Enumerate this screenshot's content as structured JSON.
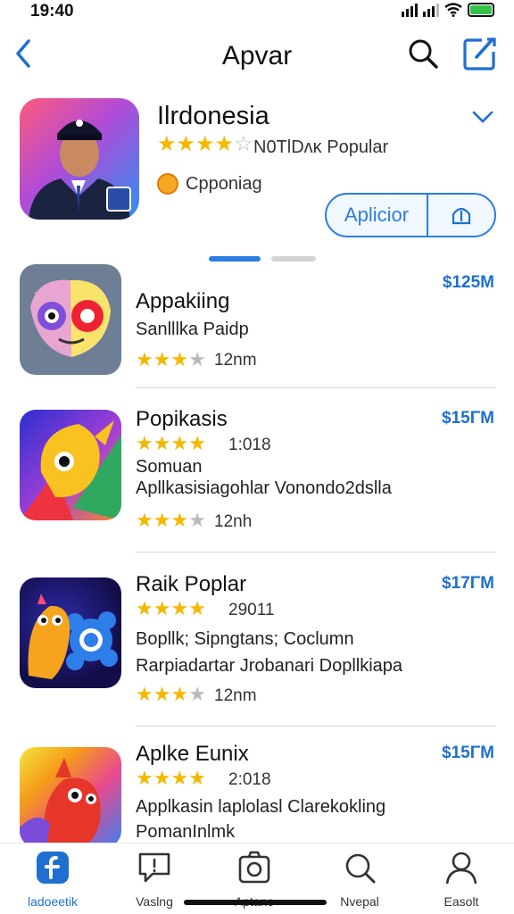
{
  "status": {
    "time": "19:40"
  },
  "nav": {
    "title": "Apvar",
    "back_icon": "chevron-left-icon",
    "search_icon": "search-icon",
    "compose_icon": "compose-icon"
  },
  "featured": {
    "title": "Ilrdonesia",
    "rating": 3.5,
    "meta": "N0TlDʌĸ Popular",
    "badge": "Cpponiag",
    "button_label": "Aplicior",
    "accent": "#2b7de0"
  },
  "pager": {
    "active": 0,
    "count": 2
  },
  "apps": [
    {
      "name": "Appakiing",
      "price": "$125M",
      "lines": [
        "Sanlllka Paidp"
      ],
      "rating": 3,
      "rating_text": "12nm"
    },
    {
      "name": "Popikasis",
      "price": "$15ΓM",
      "top_rating": 4,
      "top_meta": "1:018",
      "lines": [
        "Somuan",
        "Apllkasisiagohlar Vonondo2dslla"
      ],
      "rating": 2.5,
      "rating_text": "12nh"
    },
    {
      "name": "Raik Poplar",
      "price": "$17ΓM",
      "top_rating": 4,
      "top_meta": "29011",
      "lines": [
        "Bopllk; Sipngtans;  Coclumn",
        "Rarpiadartar Jrobanari Dopllkiapa"
      ],
      "rating": 3,
      "rating_text": "12nm"
    },
    {
      "name": "Aplke Eunix",
      "price": "$15ΓM",
      "top_rating": 4,
      "top_meta": "2:018",
      "lines": [
        "Applkasin laplolasl Clarekokling",
        "PomanInlmk"
      ]
    }
  ],
  "tabs": [
    {
      "label": "ladoeetik",
      "icon": "app-store-icon",
      "active": true
    },
    {
      "label": "Vaslng",
      "icon": "chat-icon",
      "active": false
    },
    {
      "label": "Aptane",
      "icon": "camera-icon",
      "active": false
    },
    {
      "label": "Nvepal",
      "icon": "search-icon",
      "active": false
    },
    {
      "label": "Easolt",
      "icon": "profile-icon",
      "active": false
    }
  ],
  "colors": {
    "link": "#1e6fd0",
    "star": "#f5b800",
    "star_off": "#bbbbbb"
  }
}
